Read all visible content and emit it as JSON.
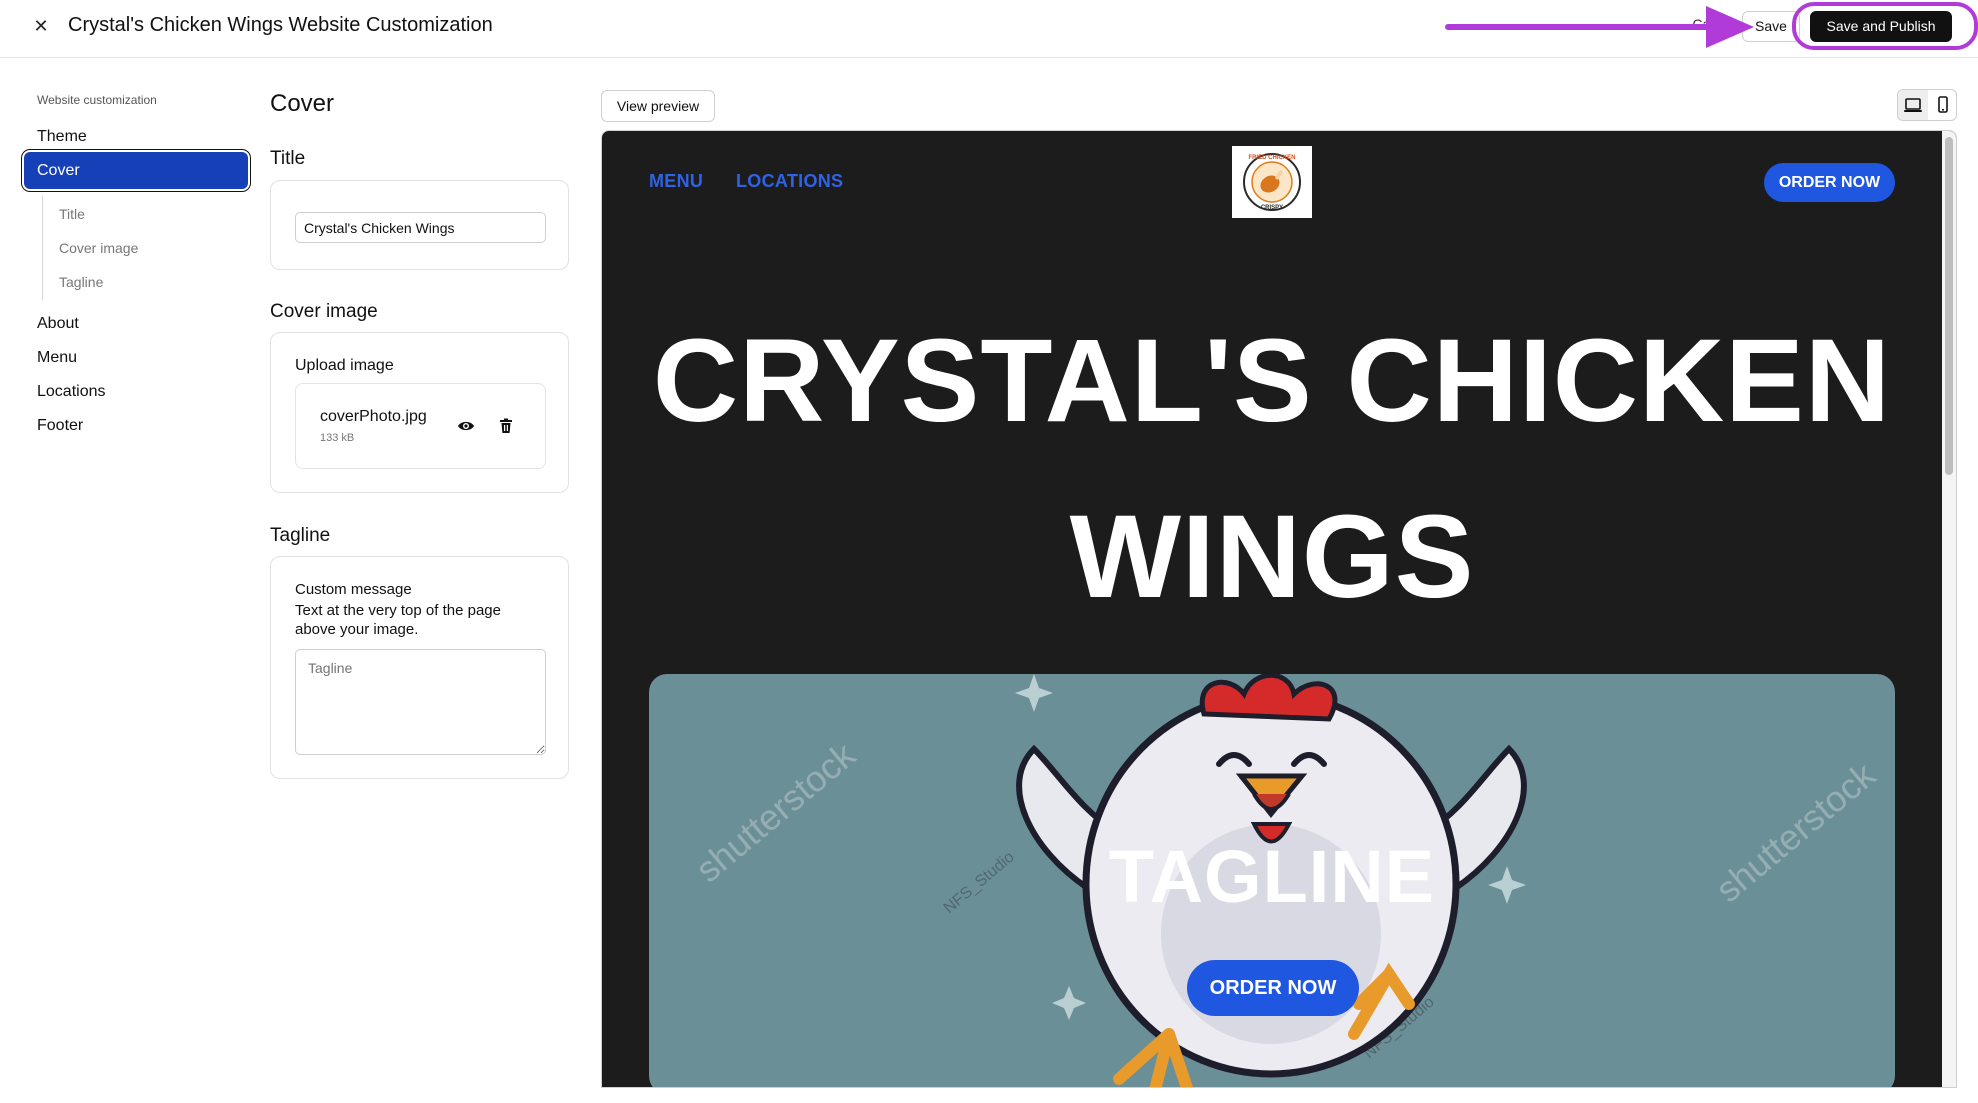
{
  "header": {
    "title": "Crystal's Chicken Wings Website Customization",
    "close_icon": "close-icon",
    "cancel_label": "Cancel",
    "save_label": "Save",
    "publish_label": "Save and Publish",
    "annotation_color": "#b13bd8"
  },
  "sidebar": {
    "heading": "Website customization",
    "items": [
      {
        "label": "Theme"
      },
      {
        "label": "Cover",
        "active": true
      },
      {
        "label": "About"
      },
      {
        "label": "Menu"
      },
      {
        "label": "Locations"
      },
      {
        "label": "Footer"
      }
    ],
    "subitems": [
      {
        "label": "Title"
      },
      {
        "label": "Cover image"
      },
      {
        "label": "Tagline"
      }
    ],
    "active_color": "#1540b8"
  },
  "form": {
    "section_title": "Cover",
    "title_field": {
      "label": "Title",
      "value": "Crystal's Chicken Wings"
    },
    "cover_image": {
      "label": "Cover image",
      "upload_label": "Upload image",
      "file_name": "coverPhoto.jpg",
      "file_size": "133 kB",
      "preview_icon": "eye-icon",
      "delete_icon": "trash-icon"
    },
    "tagline_field": {
      "label": "Tagline",
      "custom_label": "Custom message",
      "help": "Text at the very top of the page above your image.",
      "placeholder": "Tagline"
    }
  },
  "preview": {
    "view_preview_label": "View preview",
    "device_icons": [
      "desktop-icon",
      "mobile-icon"
    ],
    "nav": [
      "MENU",
      "LOCATIONS"
    ],
    "logo_text": [
      "FRIED CHICKEN",
      "CRISPY"
    ],
    "order_label": "ORDER NOW",
    "hero_title": "CRYSTAL'S CHICKEN WINGS",
    "tagline": "TAGLINE",
    "watermark": "shutterstock",
    "watermark_credit": "NFS_Studio",
    "hero_order_label": "ORDER NOW",
    "bg_color": "#1c1c1c",
    "accent_color": "#1f57e0"
  }
}
